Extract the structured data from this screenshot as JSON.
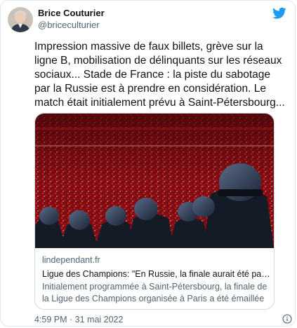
{
  "author": {
    "name": "Brice Couturier",
    "handle": "@briceculturier"
  },
  "tweet": {
    "text": "Impression massive de faux billets, grève sur la ligne B, mobilisation de délinquants sur les réseaux sociaux... Stade de France : la piste du sabotage par la Russie est à prendre en considération. Le match était initialement prévu à Saint-Pétersbourg..."
  },
  "link_card": {
    "domain": "lindependant.fr",
    "title": "Ligue des Champions: \"En Russie, la finale aurait été parfaitement organisée\"",
    "description": "Initialement programmée à Saint-Pétersbourg, la finale de la Ligue des Champions organisée à Paris a été émaillée par des incidents"
  },
  "timestamp": "4:59 PM · 31 mai 2022",
  "icons": {
    "brand": "twitter-bird-icon",
    "info": "info-icon"
  },
  "colors": {
    "twitter_blue": "#1d9bf0",
    "secondary_text": "#536471",
    "crowd_red": "#c01018"
  }
}
